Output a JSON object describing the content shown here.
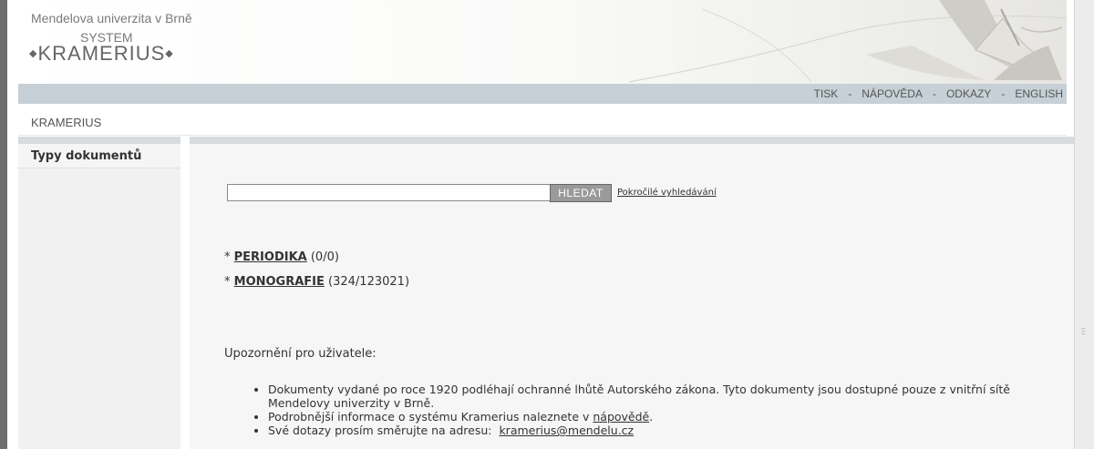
{
  "header": {
    "university": "Mendelova univerzita v Brně",
    "system": "SYSTEM",
    "product": "KRAMERIUS"
  },
  "topnav": {
    "items": [
      "TISK",
      "NÁPOVĚDA",
      "ODKAZY",
      "ENGLISH"
    ],
    "separator": "-"
  },
  "breadcrumb": {
    "label": "KRAMERIUS"
  },
  "sidebar": {
    "title": "Typy dokumentů"
  },
  "search": {
    "value": "",
    "button_label": "HLEDAT",
    "advanced_link": "Pokročilé vyhledávání"
  },
  "doc_types": [
    {
      "bullet": "*",
      "label": "PERIODIKA",
      "count": "(0/0)"
    },
    {
      "bullet": "*",
      "label": "MONOGRAFIE",
      "count": "(324/123021)"
    }
  ],
  "notice": {
    "heading": "Upozornění pro uživatele:",
    "items": {
      "copyright": "Dokumenty vydané po roce 1920 podléhají ochranné lhůtě Autorského zákona. Tyto dokumenty jsou dostupné pouze z vnitřní sítě Mendelovy univerzity v Brně.",
      "help_prefix": "Podrobnější informace o systému Kramerius naleznete v",
      "help_link": "nápovědě",
      "help_suffix": ".",
      "contact_prefix": "Své dotazy prosím směrujte na adresu:",
      "contact_email": "kramerius@mendelu.cz"
    }
  },
  "icons": {
    "book": "open-book-illustration",
    "scroll_grip": "scroll-grip-icon"
  }
}
